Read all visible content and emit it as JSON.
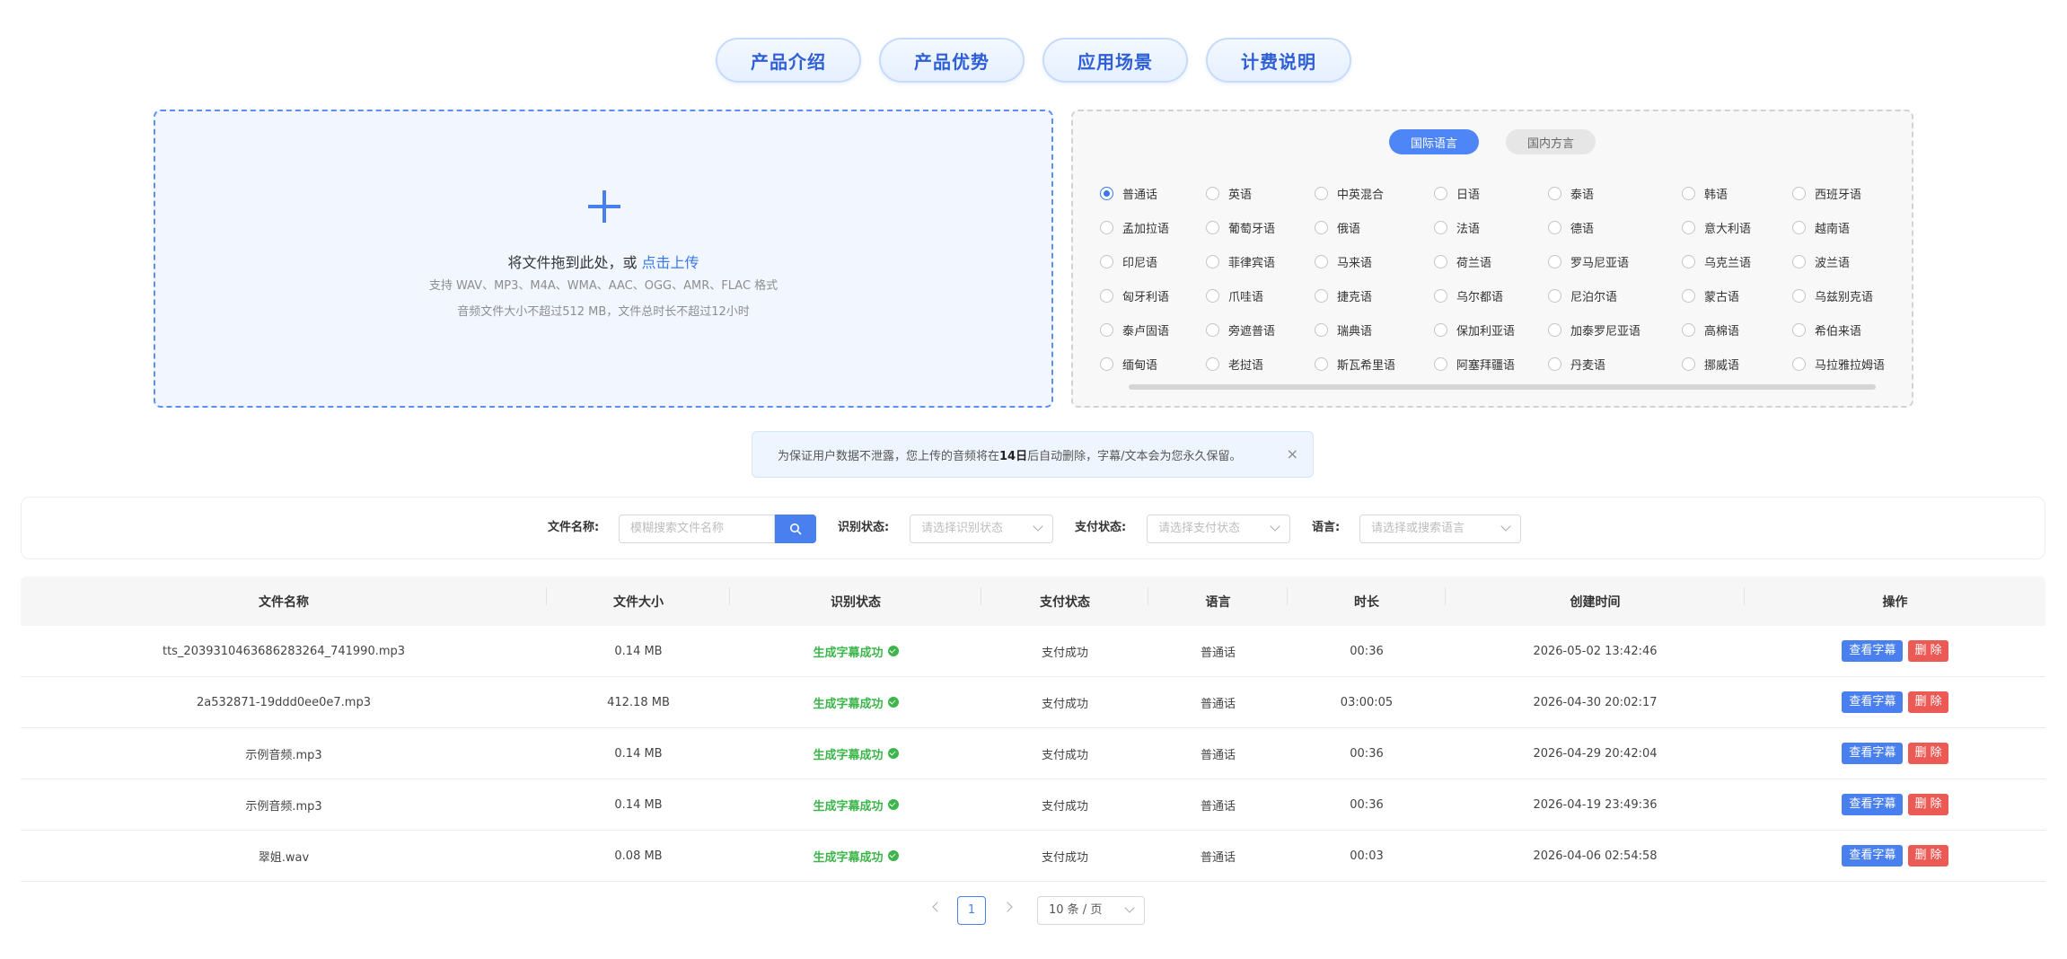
{
  "top_tabs": [
    "产品介绍",
    "产品优势",
    "应用场景",
    "计费说明"
  ],
  "upload": {
    "main_text": "将文件拖到此处，或 ",
    "link_text": "点击上传",
    "formats": "支持 WAV、MP3、M4A、WMA、AAC、OGG、AMR、FLAC 格式",
    "limits": "音频文件大小不超过512 MB，文件总时长不超过12小时"
  },
  "language_panel": {
    "tab_international": "国际语言",
    "tab_domestic": "国内方言",
    "selected": "普通话",
    "options": [
      "普通话",
      "英语",
      "中英混合",
      "日语",
      "泰语",
      "韩语",
      "西班牙语",
      "孟加拉语",
      "葡萄牙语",
      "俄语",
      "法语",
      "德语",
      "意大利语",
      "越南语",
      "印尼语",
      "菲律宾语",
      "马来语",
      "荷兰语",
      "罗马尼亚语",
      "乌克兰语",
      "波兰语",
      "匈牙利语",
      "爪哇语",
      "捷克语",
      "乌尔都语",
      "尼泊尔语",
      "蒙古语",
      "乌兹别克语",
      "泰卢固语",
      "旁遮普语",
      "瑞典语",
      "保加利亚语",
      "加泰罗尼亚语",
      "高棉语",
      "希伯来语",
      "缅甸语",
      "老挝语",
      "斯瓦希里语",
      "阿塞拜疆语",
      "丹麦语",
      "挪威语",
      "马拉雅拉姆语"
    ]
  },
  "notice": {
    "prefix": "为保证用户数据不泄露，您上传的音频将在",
    "highlight": "14日",
    "suffix": "后自动删除，字幕/文本会为您永久保留。",
    "close": "×"
  },
  "filters": {
    "file_name_label": "文件名称:",
    "file_name_placeholder": "模糊搜索文件名称",
    "recog_label": "识别状态:",
    "recog_placeholder": "请选择识别状态",
    "pay_label": "支付状态:",
    "pay_placeholder": "请选择支付状态",
    "lang_label": "语言:",
    "lang_placeholder": "请选择或搜索语言"
  },
  "table": {
    "headers": [
      "文件名称",
      "文件大小",
      "识别状态",
      "支付状态",
      "语言",
      "时长",
      "创建时间",
      "操作"
    ],
    "view_label": "查看字幕",
    "delete_label": "删 除",
    "rows": [
      {
        "name": "tts_2039310463686283264_741990.mp3",
        "size": "0.14 MB",
        "recog": "生成字幕成功",
        "pay": "支付成功",
        "lang": "普通话",
        "duration": "00:36",
        "created": "2026-05-02 13:42:46"
      },
      {
        "name": "2a532871-19ddd0ee0e7.mp3",
        "size": "412.18 MB",
        "recog": "生成字幕成功",
        "pay": "支付成功",
        "lang": "普通话",
        "duration": "03:00:05",
        "created": "2026-04-30 20:02:17"
      },
      {
        "name": "示例音频.mp3",
        "size": "0.14 MB",
        "recog": "生成字幕成功",
        "pay": "支付成功",
        "lang": "普通话",
        "duration": "00:36",
        "created": "2026-04-29 20:42:04"
      },
      {
        "name": "示例音频.mp3",
        "size": "0.14 MB",
        "recog": "生成字幕成功",
        "pay": "支付成功",
        "lang": "普通话",
        "duration": "00:36",
        "created": "2026-04-19 23:49:36"
      },
      {
        "name": "翠姐.wav",
        "size": "0.08 MB",
        "recog": "生成字幕成功",
        "pay": "支付成功",
        "lang": "普通话",
        "duration": "00:03",
        "created": "2026-04-06 02:54:58"
      }
    ]
  },
  "pagination": {
    "current_page": "1",
    "page_size": "10 条 / 页"
  },
  "colors": {
    "primary": "#4a7ff0",
    "success": "#3cb54a",
    "danger": "#ec5a55"
  }
}
